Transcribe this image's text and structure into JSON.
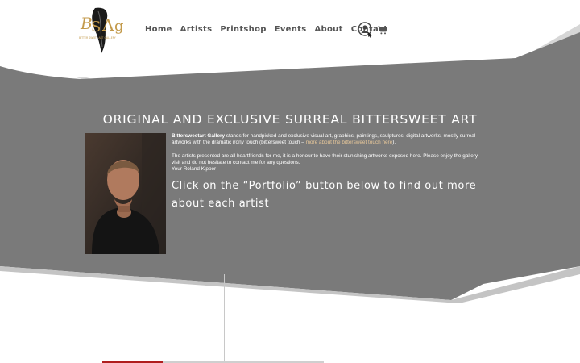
{
  "brand": {
    "logo_text": "BSAG",
    "logo_subtext": "BITTER SWEET ART GALLERY"
  },
  "nav": {
    "items": [
      {
        "label": "Home"
      },
      {
        "label": "Artists"
      },
      {
        "label": "Printshop"
      },
      {
        "label": "Events"
      },
      {
        "label": "About"
      },
      {
        "label": "Contact"
      }
    ]
  },
  "icons": {
    "account": "user-account-icon",
    "cart": "shopping-cart-icon"
  },
  "colors": {
    "band": "#7a7a7a",
    "band_shadow": "#c7c7c7",
    "link": "#e8c89a",
    "accent": "#b01e1e"
  },
  "hero": {
    "headline": "ORIGINAL AND EXCLUSIVE SURREAL BITTERSWEET ART",
    "intro_bold": "Bittersweetart Gallery",
    "intro_text": " stands for handpicked and exclusive visual art, graphics, paintings, sculptures, digital artworks, mostly surreal artworks with the dramatic irony touch (bittersweet touch – ",
    "intro_link": "more about the bittersweet touch here",
    "intro_end": ").",
    "para2": "The artists presented are all heartfriends for me, it is a honour to have their stunishing artworks exposed here. Please enjoy the gallery visit and do not hesitate to contact me for any questions.",
    "signature": "Your Roland Kipper",
    "cta": "Click on the “Portfolio” button below to find out more about each artist"
  }
}
